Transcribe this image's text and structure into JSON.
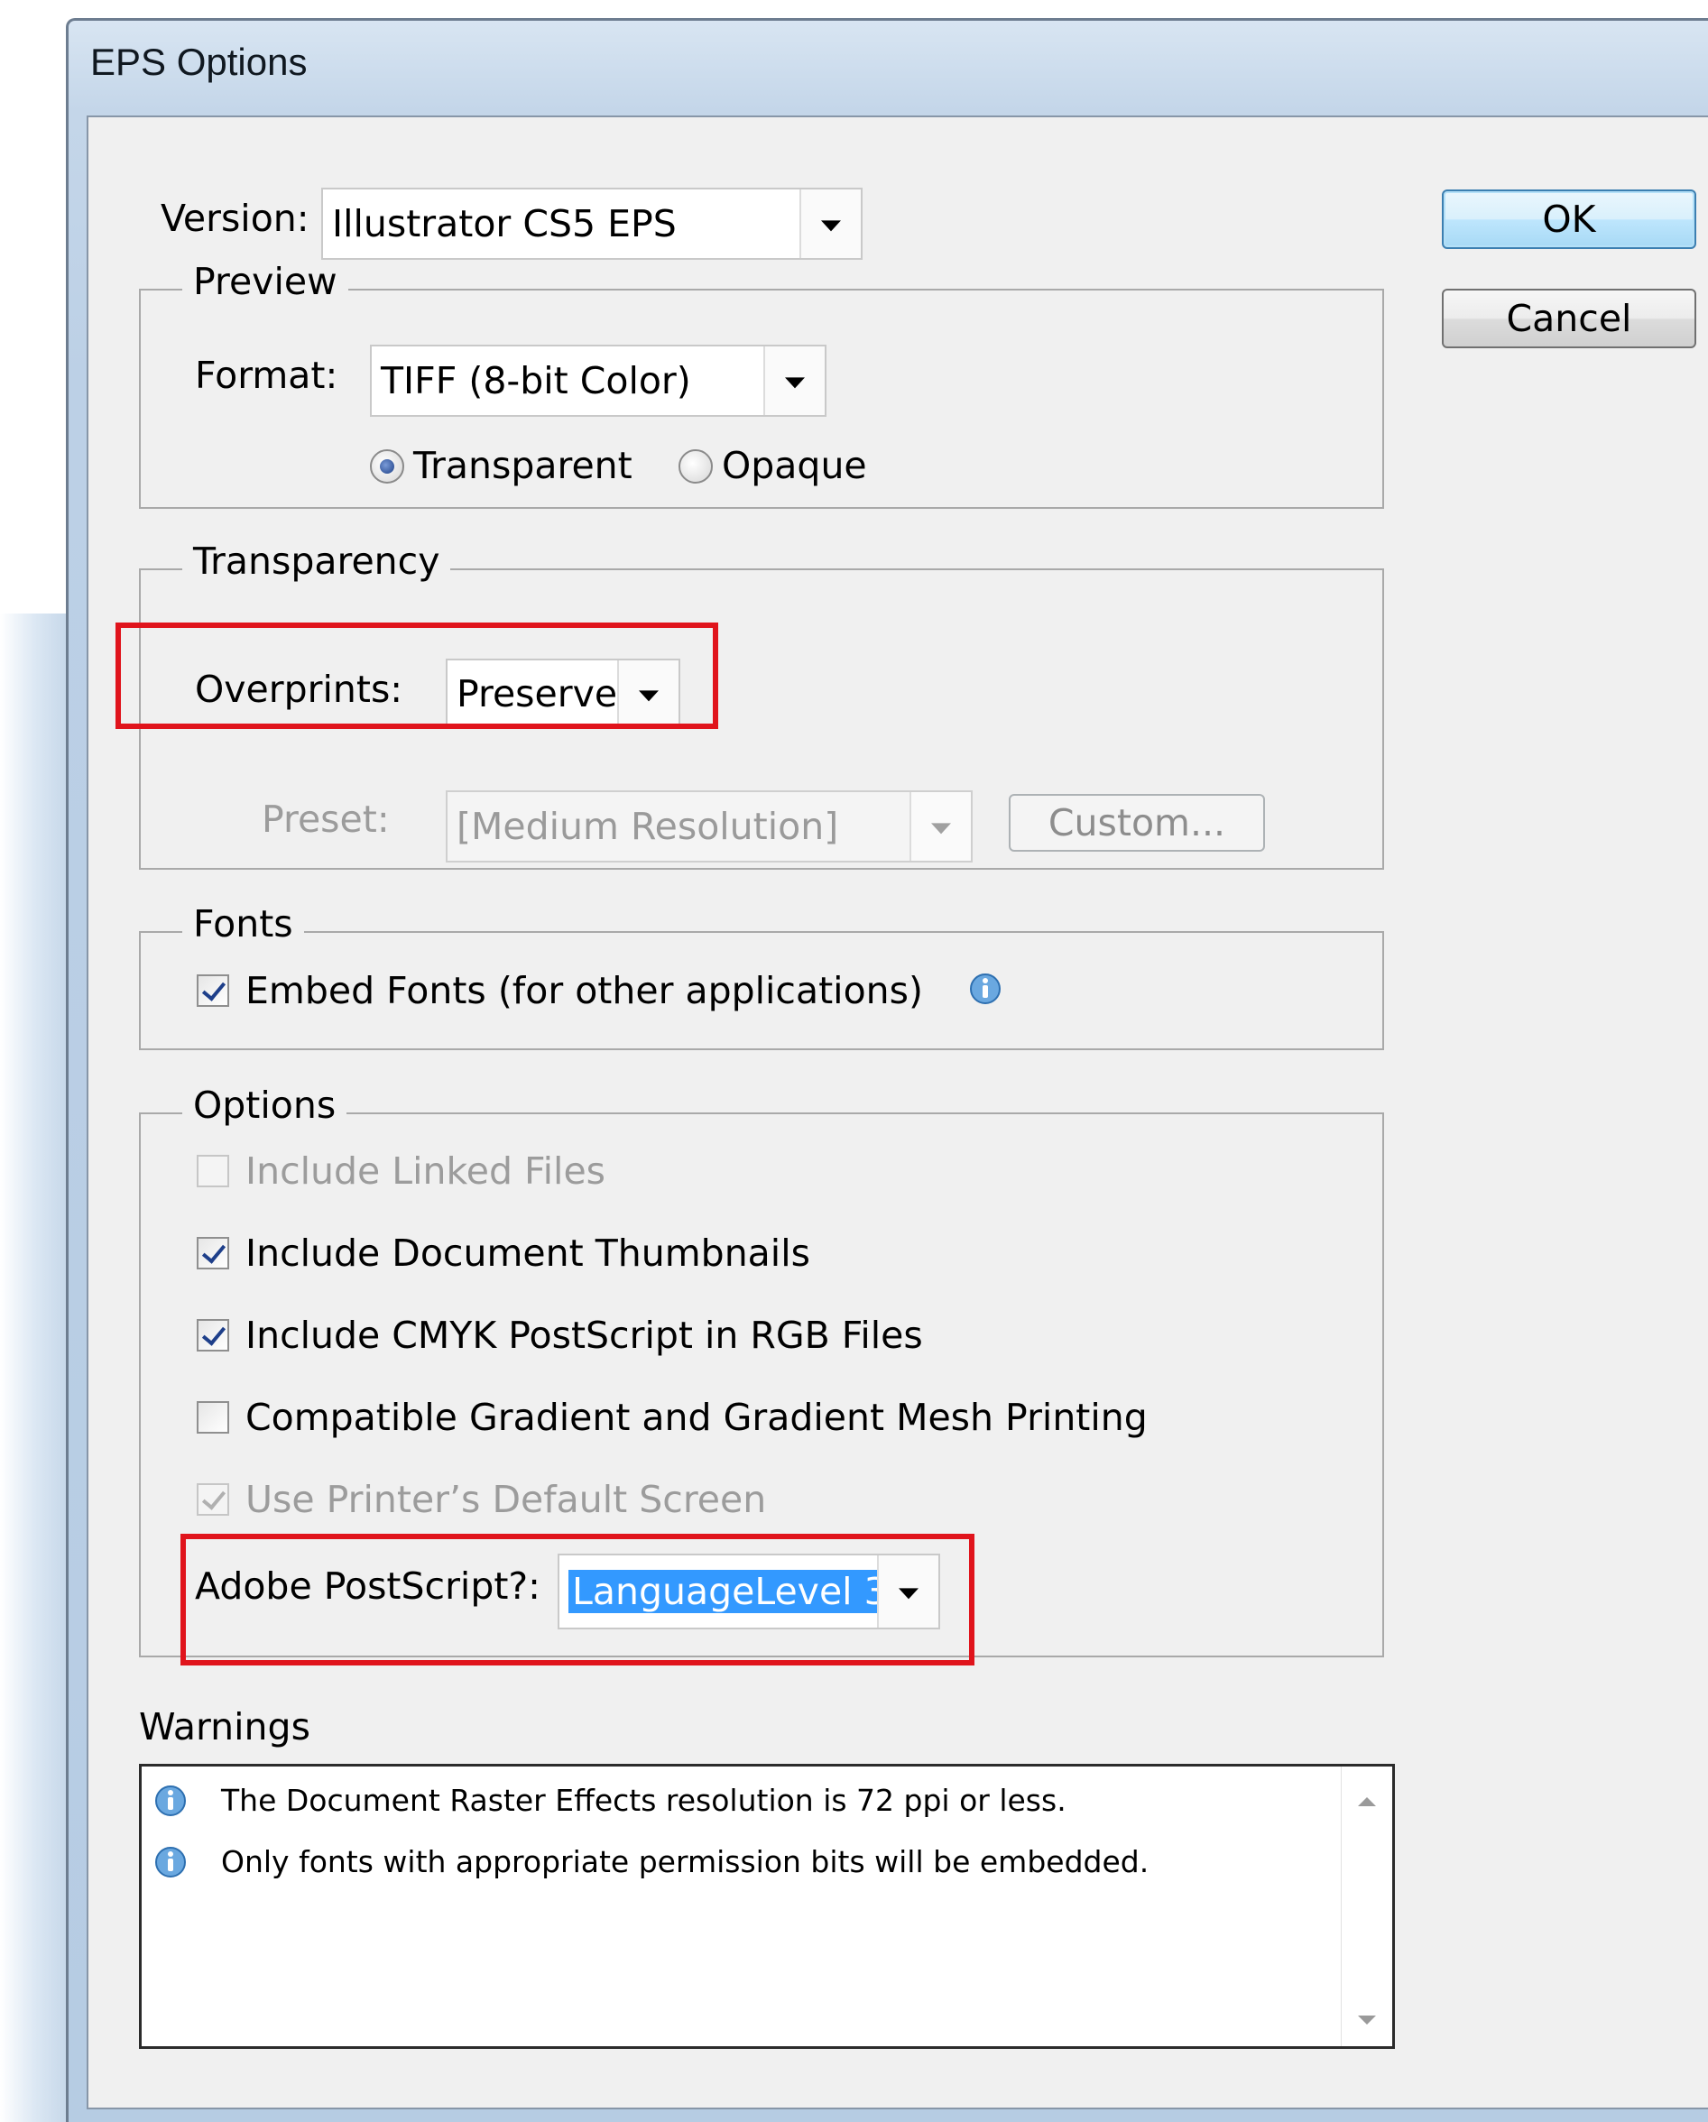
{
  "window": {
    "title": "EPS Options"
  },
  "version": {
    "label": "Version:",
    "value": "Illustrator CS5 EPS"
  },
  "buttons": {
    "ok": "OK",
    "cancel": "Cancel",
    "custom": "Custom..."
  },
  "preview": {
    "title": "Preview",
    "format_label": "Format:",
    "format_value": "TIFF (8-bit Color)",
    "radio_transparent": "Transparent",
    "radio_opaque": "Opaque"
  },
  "transparency": {
    "title": "Transparency",
    "overprints_label": "Overprints:",
    "overprints_value": "Preserve",
    "preset_label": "Preset:",
    "preset_value": "[Medium Resolution]"
  },
  "fonts": {
    "title": "Fonts",
    "embed_label": "Embed Fonts (for other applications)"
  },
  "options": {
    "title": "Options",
    "include_linked": "Include Linked Files",
    "include_thumbnails": "Include Document Thumbnails",
    "include_cmyk": "Include CMYK PostScript in RGB Files",
    "compatible_gradient": "Compatible Gradient and Gradient Mesh Printing",
    "printer_screen": "Use Printer’s Default Screen",
    "postscript_label": "Adobe PostScript?:",
    "postscript_value": "LanguageLevel 3"
  },
  "warnings": {
    "title": "Warnings",
    "items": [
      "The Document Raster Effects resolution is 72 ppi or less.",
      "Only fonts with appropriate permission bits will be embedded."
    ]
  },
  "colors": {
    "highlight": "#e0141c",
    "selection": "#3399ff"
  }
}
